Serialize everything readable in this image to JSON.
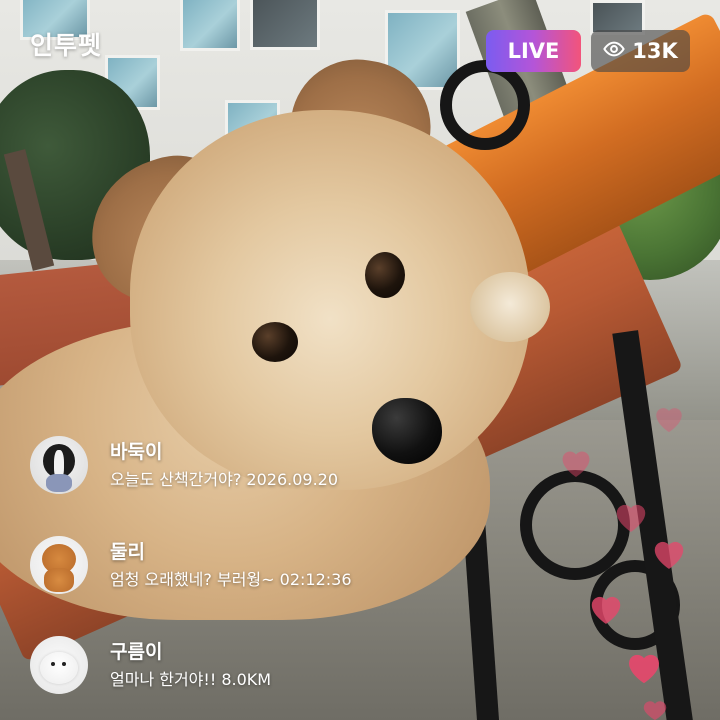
{
  "app": {
    "logo": "인투펫"
  },
  "header": {
    "live_label": "LIVE",
    "viewer_count": "13K",
    "viewer_icon": "eye-icon"
  },
  "colors": {
    "live_gradient_start": "#7b5cf0",
    "live_gradient_end": "#f2547b",
    "heart": "#e8476c",
    "viewer_badge_bg": "rgba(70,70,70,0.62)"
  },
  "comments": [
    {
      "name": "바둑이",
      "message": "오늘도 산책간거야? 2026.09.20",
      "avatar": "dog-avatar-border-collie"
    },
    {
      "name": "둘리",
      "message": "엄청 오래했네? 부러웡~ 02:12:36",
      "avatar": "dog-avatar-poodle"
    },
    {
      "name": "구름이",
      "message": "얼마나 한거야!! 8.0KM",
      "avatar": "dog-avatar-white-spitz"
    }
  ],
  "reactions": {
    "icon": "heart-icon",
    "count_visible": 7
  }
}
